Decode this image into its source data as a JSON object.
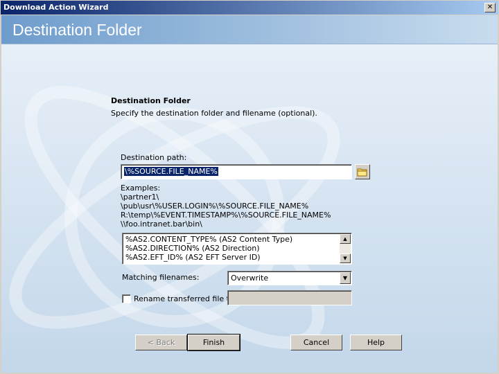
{
  "window": {
    "title": "Download Action Wizard"
  },
  "header": {
    "title": "Destination Folder"
  },
  "section": {
    "title": "Destination Folder",
    "description": "Specify the destination folder and filename (optional)."
  },
  "destination": {
    "label": "Destination path:",
    "value": "\\%SOURCE.FILE_NAME%"
  },
  "examples": {
    "heading": "Examples:",
    "lines": [
      "\\partner1\\",
      "\\pub\\usr\\%USER.LOGIN%\\%SOURCE.FILE_NAME%",
      "R:\\temp\\%EVENT.TIMESTAMP%\\%SOURCE.FILE_NAME%",
      "\\\\foo.intranet.bar\\bin\\"
    ]
  },
  "variables_list": {
    "items": [
      "%AS2.CONTENT_TYPE% (AS2 Content Type)",
      "%AS2.DIRECTION% (AS2 Direction)",
      "%AS2.EFT_ID% (AS2 EFT Server ID)"
    ]
  },
  "matching": {
    "label": "Matching filenames:",
    "selected": "Overwrite"
  },
  "rename": {
    "label": "Rename transferred file to",
    "checked": false,
    "value": ""
  },
  "buttons": {
    "back": "< Back",
    "finish": "Finish",
    "cancel": "Cancel",
    "help": "Help"
  },
  "icons": {
    "close": "close-icon",
    "browse": "folder-icon",
    "scroll_up": "scroll-up-icon",
    "scroll_down": "scroll-down-icon",
    "dropdown": "chevron-down-icon"
  },
  "colors": {
    "titlebar_start": "#0a246a",
    "titlebar_end": "#a6caf0",
    "header_band": "#6e9ccc",
    "background": "#d4d0c8"
  }
}
